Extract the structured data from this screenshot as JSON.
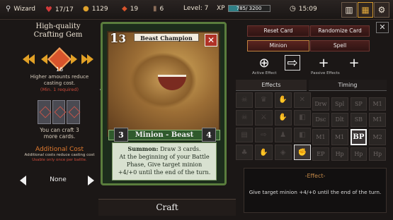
{
  "topbar": {
    "player_name": "Wizard",
    "hp": "17/17",
    "gold": "1129",
    "stat_fire": "19",
    "stat_bag": "6",
    "level": "Level: 7",
    "xp_label": "XP",
    "xp_text": "785/ 3200",
    "xp_fraction": 0.245,
    "time": "15:09"
  },
  "gem": {
    "title_line1": "High-quality",
    "title_line2": "Crafting Gem",
    "count": "16",
    "desc1": "Higher amounts reduce",
    "desc2": "casting cost.",
    "required": "(Min. 1 required)"
  },
  "craftable": {
    "line1": "You can craft 3",
    "line2": "more cards."
  },
  "additional_cost": {
    "title": "Additional Cost",
    "desc": "Additional costs reduce casting cost",
    "note": "Usable only once per battle.",
    "value": "None"
  },
  "card": {
    "cost": "1",
    "cost2": "3",
    "name": "Beast Champion",
    "type": "Minion - Beast",
    "attack": "3",
    "health": "4",
    "summon_label": "Summon:",
    "text_line1": " Draw 3 cards.",
    "text_line2": "At the beginning of your Battle",
    "text_line3": "Phase, Give target minion",
    "text_line4": "+4/+0 until the end of the turn."
  },
  "right": {
    "reset_label": "Reset Card",
    "randomize_label": "Randomize Card",
    "minion_label": "Minion",
    "spell_label": "Spell",
    "active_effect_label": "Active Effect",
    "passive_effects_label": "Passive Effects",
    "tab_effects": "Effects",
    "tab_timing": "Timing",
    "timing_codes": [
      "Drw",
      "Spl",
      "SP",
      "M1",
      "Dsc",
      "Dlt",
      "SB",
      "M1",
      "M1",
      "M1",
      "BP",
      "M2",
      "EP",
      "Hp",
      "Hp",
      "Hp"
    ],
    "effect_heading": "-Effect-",
    "effect_text": "Give target minion +4/+0 until the end of the turn."
  },
  "craft_label": "Craft",
  "colors": {
    "accent_orange": "#e2a126",
    "button_red": "#4a1f1d",
    "card_green": "#5a7d3d"
  }
}
